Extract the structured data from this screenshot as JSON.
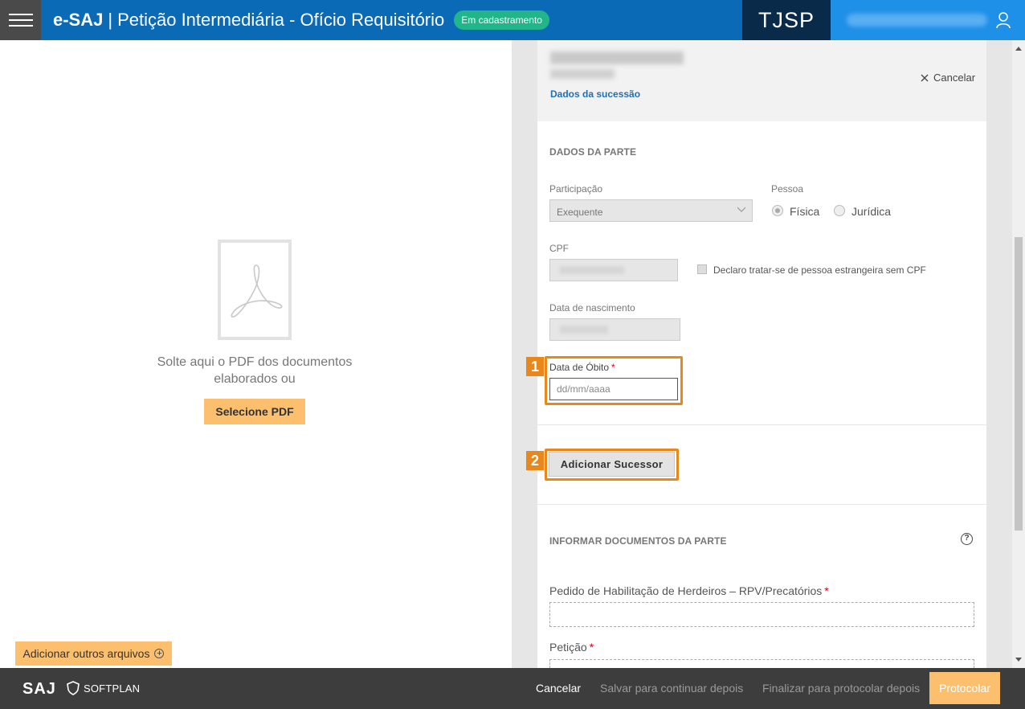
{
  "header": {
    "brand": "e-SAJ",
    "separator": "|",
    "title": "Petição Intermediária - Ofício Requisitório",
    "status_badge": "Em cadastramento",
    "court": "TJSP"
  },
  "left_pane": {
    "drop_text": "Solte aqui o PDF dos documentos elaborados ou",
    "select_pdf_label": "Selecione PDF",
    "add_files_label": "Adicionar outros arquivos"
  },
  "succession": {
    "link": "Dados da sucessão",
    "cancel_label": "Cancelar"
  },
  "party": {
    "section_title": "DADOS DA PARTE",
    "participacao_label": "Participação",
    "participacao_value": "Exequente",
    "pessoa_label": "Pessoa",
    "pessoa_options": [
      "Física",
      "Jurídica"
    ],
    "pessoa_selected": "Física",
    "cpf_label": "CPF",
    "foreign_checkbox_label": "Declaro tratar-se de pessoa estrangeira sem CPF",
    "birth_label": "Data de nascimento",
    "death_label": "Data de Óbito",
    "required_mark": "*",
    "death_placeholder": "dd/mm/aaaa"
  },
  "steps": {
    "one": "1",
    "two": "2"
  },
  "add_successor_label": "Adicionar Sucessor",
  "documents": {
    "section_title": "INFORMAR DOCUMENTOS DA PARTE",
    "help": "?",
    "doc1_label": "Pedido de Habilitação de Herdeiros – RPV/Precatórios",
    "doc2_label": "Petição"
  },
  "footer": {
    "logo_saj": "SAJ",
    "logo_softplan": "SOFTPLAN",
    "cancel": "Cancelar",
    "save_later": "Salvar para continuar depois",
    "finalize_later": "Finalizar para protocolar depois",
    "protocol": "Protocolar"
  },
  "colors": {
    "header_blue": "#0a6ab5",
    "court_navy": "#0a2a4a",
    "user_blue": "#1e90e8",
    "badge_green": "#21b58a",
    "accent_orange": "#fbbf6e",
    "highlight_orange": "#e8881c",
    "footer_dark": "#3d3d3d"
  }
}
